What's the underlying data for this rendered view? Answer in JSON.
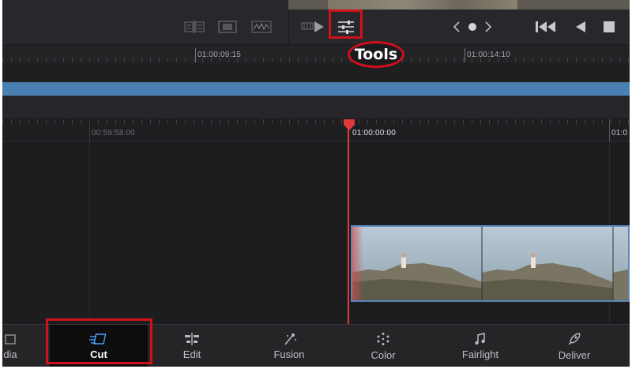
{
  "toolbar": {
    "buttons": [
      {
        "name": "split-view-icon"
      },
      {
        "name": "viewer-layout-icon"
      },
      {
        "name": "waveform-icon"
      },
      {
        "name": "play-clip-icon"
      },
      {
        "name": "sliders-icon"
      },
      {
        "name": "prev-marker-icon"
      },
      {
        "name": "marker-dot-icon"
      },
      {
        "name": "next-marker-icon"
      },
      {
        "name": "skip-to-start-icon"
      },
      {
        "name": "play-reverse-icon"
      },
      {
        "name": "stop-icon"
      }
    ],
    "tooltip": "Tools"
  },
  "ruler_top": {
    "labels": [
      "01:00:09:15",
      "01:00:14:10"
    ]
  },
  "ruler_bottom": {
    "labels": [
      "00:59:58:00",
      "01:00:00:00",
      "01:0"
    ]
  },
  "playhead": {
    "color": "#e03a3a"
  },
  "clip": {
    "border_color": "#5b86b8"
  },
  "pages": [
    {
      "label": "dia",
      "icon": "media-icon"
    },
    {
      "label": "Cut",
      "icon": "cut-icon",
      "active": true
    },
    {
      "label": "Edit",
      "icon": "edit-icon"
    },
    {
      "label": "Fusion",
      "icon": "fusion-icon"
    },
    {
      "label": "Color",
      "icon": "color-icon"
    },
    {
      "label": "Fairlight",
      "icon": "fairlight-icon"
    },
    {
      "label": "Deliver",
      "icon": "deliver-icon"
    }
  ],
  "colors": {
    "highlight": "#d0101a",
    "timeline_bar": "#4a7fb2",
    "background": "#1f1f22"
  }
}
